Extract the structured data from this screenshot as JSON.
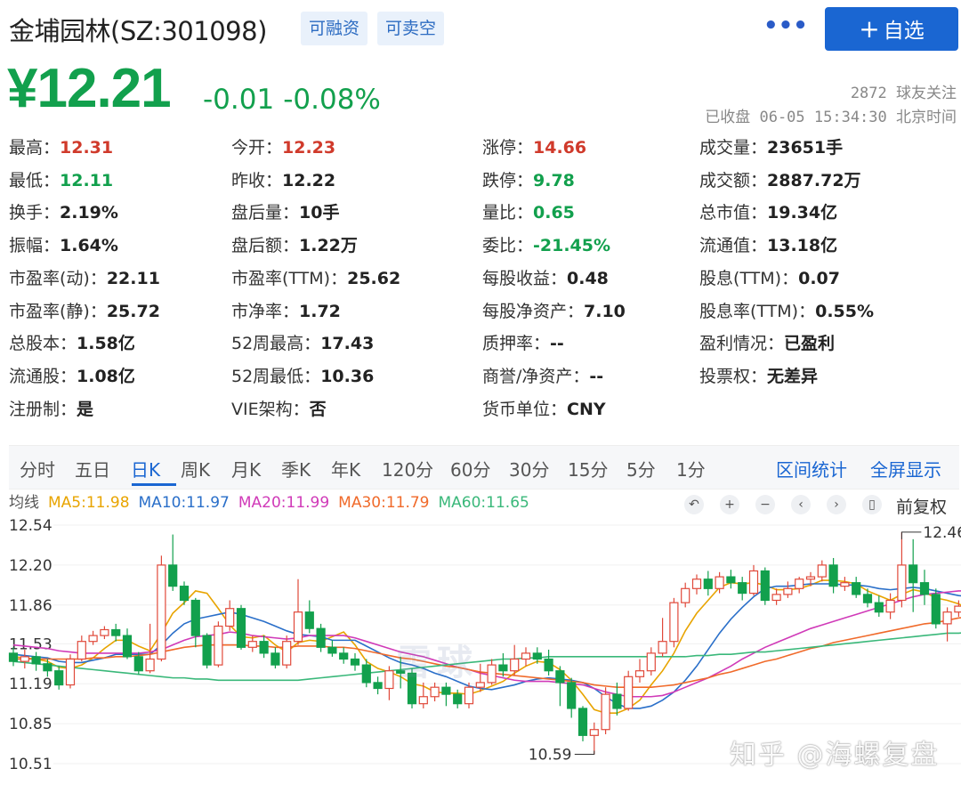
{
  "header": {
    "stock_name": "金埔园林(SZ:301098)",
    "tag1": "可融资",
    "tag2": "可卖空",
    "more_label": "•••",
    "add_label": "自选",
    "add_icon": "plus-icon"
  },
  "quote": {
    "price": "¥12.21",
    "change": "-0.01",
    "change_pct": "-0.08%",
    "followers": "2872 球友关注",
    "status": "已收盘 06-05 15:34:30 北京时间"
  },
  "stats": [
    {
      "label": "最高：",
      "value": "12.31",
      "color": "red"
    },
    {
      "label": "今开：",
      "value": "12.23",
      "color": "red"
    },
    {
      "label": "涨停：",
      "value": "14.66",
      "color": "red"
    },
    {
      "label": "成交量：",
      "value": "23651手",
      "color": ""
    },
    {
      "label": "最低：",
      "value": "12.11",
      "color": "green"
    },
    {
      "label": "昨收：",
      "value": "12.22",
      "color": ""
    },
    {
      "label": "跌停：",
      "value": "9.78",
      "color": "green"
    },
    {
      "label": "成交额：",
      "value": "2887.72万",
      "color": ""
    },
    {
      "label": "换手：",
      "value": "2.19%",
      "color": ""
    },
    {
      "label": "盘后量：",
      "value": "10手",
      "color": ""
    },
    {
      "label": "量比：",
      "value": "0.65",
      "color": "green"
    },
    {
      "label": "总市值：",
      "value": "19.34亿",
      "color": ""
    },
    {
      "label": "振幅：",
      "value": "1.64%",
      "color": ""
    },
    {
      "label": "盘后额：",
      "value": "1.22万",
      "color": ""
    },
    {
      "label": "委比：",
      "value": "-21.45%",
      "color": "green"
    },
    {
      "label": "流通值：",
      "value": "13.18亿",
      "color": ""
    },
    {
      "label": "市盈率(动)：",
      "value": "22.11",
      "color": ""
    },
    {
      "label": "市盈率(TTM)：",
      "value": "25.62",
      "color": ""
    },
    {
      "label": "每股收益：",
      "value": "0.48",
      "color": ""
    },
    {
      "label": "股息(TTM)：",
      "value": "0.07",
      "color": ""
    },
    {
      "label": "市盈率(静)：",
      "value": "25.72",
      "color": ""
    },
    {
      "label": "市净率：",
      "value": "1.72",
      "color": ""
    },
    {
      "label": "每股净资产：",
      "value": "7.10",
      "color": ""
    },
    {
      "label": "股息率(TTM)：",
      "value": "0.55%",
      "color": ""
    },
    {
      "label": "总股本：",
      "value": "1.58亿",
      "color": ""
    },
    {
      "label": "52周最高：",
      "value": "17.43",
      "color": ""
    },
    {
      "label": "质押率：",
      "value": "--",
      "color": ""
    },
    {
      "label": "盈利情况：",
      "value": "已盈利",
      "color": ""
    },
    {
      "label": "流通股：",
      "value": "1.08亿",
      "color": ""
    },
    {
      "label": "52周最低：",
      "value": "10.36",
      "color": ""
    },
    {
      "label": "商誉/净资产：",
      "value": "--",
      "color": ""
    },
    {
      "label": "投票权：",
      "value": "无差异",
      "color": ""
    },
    {
      "label": "注册制：",
      "value": "是",
      "color": ""
    },
    {
      "label": "VIE架构：",
      "value": "否",
      "color": ""
    },
    {
      "label": "货币单位：",
      "value": "CNY",
      "color": ""
    }
  ],
  "tabs": [
    "分时",
    "五日",
    "日K",
    "周K",
    "月K",
    "季K",
    "年K",
    "120分",
    "60分",
    "30分",
    "15分",
    "5分",
    "1分"
  ],
  "active_tab": "日K",
  "tab_actions": [
    "区间统计",
    "全屏显示"
  ],
  "ma": {
    "label": "均线",
    "items": [
      {
        "text": "MA5:11.98",
        "color": "#e8a400"
      },
      {
        "text": "MA10:11.97",
        "color": "#2a6fc9"
      },
      {
        "text": "MA20:11.99",
        "color": "#d03ab8"
      },
      {
        "text": "MA30:11.79",
        "color": "#f06a2a"
      },
      {
        "text": "MA60:11.65",
        "color": "#3ab87a"
      }
    ]
  },
  "controls": [
    {
      "name": "undo-icon",
      "glyph": "↶"
    },
    {
      "name": "zoom-in-icon",
      "glyph": "+"
    },
    {
      "name": "zoom-out-icon",
      "glyph": "−"
    },
    {
      "name": "prev-icon",
      "glyph": "‹"
    },
    {
      "name": "next-icon",
      "glyph": "›"
    },
    {
      "name": "candle-icon",
      "glyph": "▯"
    }
  ],
  "restore_label": "前复权",
  "watermark": "知乎 @海螺复盘",
  "logo_watermark": "雪球",
  "chart_data": {
    "type": "candlestick",
    "y_ticks": [
      "12.54",
      "12.20",
      "11.86",
      "11.53",
      "11.19",
      "10.85",
      "10.51"
    ],
    "ylim": [
      10.51,
      12.54
    ],
    "max_annotation": "12.46",
    "min_annotation": "10.59",
    "up_color": "#e0493a",
    "down_color": "#12a04d",
    "candles": [
      [
        11.45,
        11.38,
        11.5,
        11.34
      ],
      [
        11.38,
        11.42,
        11.48,
        11.32
      ],
      [
        11.42,
        11.36,
        11.46,
        11.3
      ],
      [
        11.36,
        11.3,
        11.4,
        11.25
      ],
      [
        11.3,
        11.18,
        11.34,
        11.14
      ],
      [
        11.18,
        11.4,
        11.44,
        11.15
      ],
      [
        11.4,
        11.55,
        11.6,
        11.38
      ],
      [
        11.55,
        11.6,
        11.64,
        11.52
      ],
      [
        11.6,
        11.65,
        11.68,
        11.57
      ],
      [
        11.65,
        11.6,
        11.7,
        11.55
      ],
      [
        11.6,
        11.42,
        11.66,
        11.4
      ],
      [
        11.42,
        11.3,
        11.46,
        11.27
      ],
      [
        11.3,
        11.4,
        11.7,
        11.28
      ],
      [
        11.4,
        12.2,
        12.28,
        11.38
      ],
      [
        12.2,
        12.02,
        12.46,
        11.98
      ],
      [
        12.02,
        11.9,
        12.06,
        11.86
      ],
      [
        11.9,
        11.6,
        11.92,
        11.5
      ],
      [
        11.6,
        11.35,
        11.62,
        11.32
      ],
      [
        11.35,
        11.68,
        11.72,
        11.33
      ],
      [
        11.68,
        11.83,
        11.9,
        11.64
      ],
      [
        11.83,
        11.5,
        11.86,
        11.48
      ],
      [
        11.5,
        11.55,
        11.6,
        11.46
      ],
      [
        11.55,
        11.45,
        11.6,
        11.41
      ],
      [
        11.45,
        11.35,
        11.5,
        11.32
      ],
      [
        11.35,
        11.55,
        11.6,
        11.32
      ],
      [
        11.55,
        11.8,
        12.08,
        11.52
      ],
      [
        11.8,
        11.66,
        11.9,
        11.62
      ],
      [
        11.66,
        11.5,
        11.7,
        11.46
      ],
      [
        11.5,
        11.45,
        11.56,
        11.42
      ],
      [
        11.45,
        11.4,
        11.5,
        11.36
      ],
      [
        11.4,
        11.35,
        11.45,
        11.3
      ],
      [
        11.35,
        11.2,
        11.4,
        11.16
      ],
      [
        11.2,
        11.15,
        11.25,
        11.1
      ],
      [
        11.15,
        11.3,
        11.34,
        11.05
      ],
      [
        11.3,
        11.28,
        11.42,
        11.15
      ],
      [
        11.28,
        11.02,
        11.32,
        10.98
      ],
      [
        11.02,
        11.08,
        11.2,
        10.98
      ],
      [
        11.08,
        11.16,
        11.2,
        11.04
      ],
      [
        11.16,
        11.1,
        11.2,
        11.0
      ],
      [
        11.1,
        11.02,
        11.14,
        10.98
      ],
      [
        11.02,
        11.16,
        11.2,
        10.98
      ],
      [
        11.16,
        11.2,
        11.36,
        11.12
      ],
      [
        11.2,
        11.35,
        11.4,
        11.18
      ],
      [
        11.35,
        11.3,
        11.45,
        11.25
      ],
      [
        11.3,
        11.4,
        11.52,
        11.26
      ],
      [
        11.4,
        11.45,
        11.5,
        11.34
      ],
      [
        11.45,
        11.4,
        11.5,
        11.36
      ],
      [
        11.4,
        11.3,
        11.48,
        11.26
      ],
      [
        11.3,
        11.2,
        11.34,
        11.0
      ],
      [
        11.2,
        10.98,
        11.24,
        10.9
      ],
      [
        10.98,
        10.75,
        11.0,
        10.7
      ],
      [
        10.75,
        10.8,
        10.86,
        10.59
      ],
      [
        10.8,
        11.1,
        11.16,
        10.76
      ],
      [
        11.1,
        10.98,
        11.2,
        10.92
      ],
      [
        10.98,
        11.25,
        11.3,
        10.96
      ],
      [
        11.25,
        11.3,
        11.4,
        11.2
      ],
      [
        11.3,
        11.45,
        11.5,
        11.26
      ],
      [
        11.45,
        11.55,
        11.75,
        11.42
      ],
      [
        11.55,
        11.88,
        11.92,
        11.5
      ],
      [
        11.88,
        12.0,
        12.05,
        11.84
      ],
      [
        12.0,
        12.08,
        12.12,
        11.95
      ],
      [
        12.08,
        12.0,
        12.15,
        11.94
      ],
      [
        12.0,
        12.1,
        12.14,
        11.96
      ],
      [
        12.1,
        12.05,
        12.16,
        12.0
      ],
      [
        12.05,
        11.96,
        12.1,
        11.9
      ],
      [
        11.96,
        12.15,
        12.2,
        11.94
      ],
      [
        12.15,
        11.9,
        12.18,
        11.86
      ],
      [
        11.9,
        11.95,
        12.0,
        11.86
      ],
      [
        11.95,
        12.0,
        12.06,
        11.92
      ],
      [
        12.0,
        12.08,
        12.1,
        11.96
      ],
      [
        12.08,
        12.1,
        12.14,
        12.02
      ],
      [
        12.1,
        12.2,
        12.24,
        12.06
      ],
      [
        12.2,
        12.02,
        12.26,
        11.96
      ],
      [
        12.02,
        12.05,
        12.1,
        11.98
      ],
      [
        12.05,
        11.95,
        12.1,
        11.92
      ],
      [
        11.95,
        11.88,
        12.0,
        11.84
      ],
      [
        11.88,
        11.8,
        11.94,
        11.76
      ],
      [
        11.8,
        11.9,
        11.96,
        11.74
      ],
      [
        11.9,
        12.2,
        12.48,
        11.84
      ],
      [
        12.2,
        12.05,
        12.42,
        11.8
      ],
      [
        12.05,
        11.95,
        12.16,
        11.86
      ],
      [
        11.95,
        11.7,
        12.0,
        11.66
      ],
      [
        11.7,
        11.8,
        11.84,
        11.55
      ],
      [
        11.8,
        11.85,
        11.9,
        11.76
      ],
      [
        11.85,
        11.8,
        11.9,
        11.56
      ],
      [
        11.8,
        12.22,
        12.24,
        11.78
      ],
      [
        12.22,
        12.21,
        12.31,
        12.11
      ]
    ],
    "ma_series": [
      {
        "name": "MA5",
        "color": "#e8a400",
        "values": [
          11.42,
          11.41,
          11.4,
          11.38,
          11.33,
          11.32,
          11.35,
          11.41,
          11.49,
          11.56,
          11.56,
          11.51,
          11.47,
          11.62,
          11.79,
          11.88,
          11.98,
          11.96,
          11.83,
          11.69,
          11.59,
          11.58,
          11.6,
          11.52,
          11.46,
          11.54,
          11.56,
          11.55,
          11.59,
          11.63,
          11.52,
          11.38,
          11.32,
          11.29,
          11.25,
          11.19,
          11.17,
          11.12,
          11.11,
          11.11,
          11.1,
          11.13,
          11.17,
          11.21,
          11.28,
          11.34,
          11.38,
          11.37,
          11.31,
          11.22,
          11.1,
          10.97,
          10.94,
          10.94,
          10.98,
          11.05,
          11.18,
          11.3,
          11.45,
          11.64,
          11.79,
          11.9,
          12.01,
          12.05,
          12.04,
          12.05,
          12.03,
          11.99,
          11.99,
          12.0,
          12.03,
          12.07,
          12.07,
          12.06,
          12.04,
          11.98,
          11.94,
          11.9,
          11.95,
          11.99,
          11.97,
          11.92,
          11.9,
          11.87,
          11.82,
          11.89,
          11.98
        ]
      },
      {
        "name": "MA10",
        "color": "#2a6fc9",
        "values": [
          11.44,
          11.43,
          11.42,
          11.41,
          11.38,
          11.37,
          11.37,
          11.39,
          11.41,
          11.44,
          11.44,
          11.44,
          11.44,
          11.52,
          11.62,
          11.7,
          11.74,
          11.76,
          11.78,
          11.8,
          11.78,
          11.75,
          11.72,
          11.68,
          11.64,
          11.61,
          11.6,
          11.59,
          11.56,
          11.56,
          11.56,
          11.51,
          11.46,
          11.41,
          11.37,
          11.35,
          11.32,
          11.28,
          11.25,
          11.21,
          11.17,
          11.15,
          11.14,
          11.16,
          11.18,
          11.21,
          11.23,
          11.24,
          11.23,
          11.22,
          11.2,
          11.15,
          11.08,
          11.02,
          10.98,
          10.98,
          11.0,
          11.05,
          11.12,
          11.22,
          11.34,
          11.48,
          11.62,
          11.74,
          11.84,
          11.93,
          12.0,
          12.02,
          12.02,
          12.03,
          12.04,
          12.04,
          12.04,
          12.03,
          12.03,
          12.02,
          12.0,
          11.99,
          12.0,
          12.01,
          12.0,
          11.98,
          11.96,
          11.94,
          11.93,
          11.94,
          11.97
        ]
      },
      {
        "name": "MA20",
        "color": "#d03ab8",
        "values": [
          11.52,
          11.51,
          11.5,
          11.49,
          11.47,
          11.46,
          11.45,
          11.45,
          11.45,
          11.45,
          11.45,
          11.45,
          11.46,
          11.48,
          11.52,
          11.56,
          11.59,
          11.6,
          11.61,
          11.63,
          11.62,
          11.6,
          11.59,
          11.58,
          11.57,
          11.58,
          11.6,
          11.6,
          11.6,
          11.6,
          11.58,
          11.55,
          11.52,
          11.49,
          11.46,
          11.44,
          11.42,
          11.39,
          11.36,
          11.33,
          11.31,
          11.28,
          11.26,
          11.24,
          11.22,
          11.21,
          11.21,
          11.21,
          11.2,
          11.19,
          11.18,
          11.15,
          11.12,
          11.1,
          11.08,
          11.08,
          11.08,
          11.09,
          11.12,
          11.16,
          11.2,
          11.24,
          11.29,
          11.34,
          11.4,
          11.45,
          11.5,
          11.54,
          11.58,
          11.62,
          11.66,
          11.69,
          11.72,
          11.75,
          11.78,
          11.81,
          11.84,
          11.87,
          11.9,
          11.93,
          11.95,
          11.96,
          11.97,
          11.98,
          11.98,
          11.98,
          11.99
        ]
      },
      {
        "name": "MA30",
        "color": "#f06a2a",
        "values": [
          11.4,
          11.4,
          11.4,
          11.4,
          11.4,
          11.4,
          11.4,
          11.41,
          11.41,
          11.42,
          11.42,
          11.43,
          11.44,
          11.46,
          11.48,
          11.5,
          11.51,
          11.52,
          11.52,
          11.52,
          11.52,
          11.51,
          11.51,
          11.5,
          11.5,
          11.51,
          11.51,
          11.51,
          11.5,
          11.5,
          11.49,
          11.47,
          11.45,
          11.43,
          11.41,
          11.4,
          11.38,
          11.36,
          11.34,
          11.33,
          11.31,
          11.29,
          11.28,
          11.27,
          11.26,
          11.25,
          11.24,
          11.23,
          11.22,
          11.21,
          11.2,
          11.18,
          11.17,
          11.16,
          11.16,
          11.16,
          11.16,
          11.17,
          11.18,
          11.2,
          11.22,
          11.24,
          11.27,
          11.29,
          11.32,
          11.35,
          11.38,
          11.4,
          11.43,
          11.46,
          11.49,
          11.51,
          11.54,
          11.56,
          11.58,
          11.6,
          11.62,
          11.64,
          11.66,
          11.68,
          11.7,
          11.71,
          11.73,
          11.75,
          11.76,
          11.77,
          11.79
        ]
      },
      {
        "name": "MA60",
        "color": "#3ab87a",
        "values": [
          11.38,
          11.37,
          11.36,
          11.35,
          11.34,
          11.33,
          11.32,
          11.31,
          11.3,
          11.29,
          11.28,
          11.27,
          11.26,
          11.25,
          11.24,
          11.24,
          11.23,
          11.23,
          11.22,
          11.22,
          11.22,
          11.22,
          11.22,
          11.22,
          11.22,
          11.22,
          11.23,
          11.24,
          11.25,
          11.26,
          11.27,
          11.28,
          11.29,
          11.3,
          11.31,
          11.32,
          11.33,
          11.34,
          11.35,
          11.36,
          11.37,
          11.38,
          11.39,
          11.4,
          11.4,
          11.41,
          11.41,
          11.42,
          11.42,
          11.42,
          11.42,
          11.42,
          11.42,
          11.42,
          11.42,
          11.42,
          11.42,
          11.42,
          11.42,
          11.42,
          11.43,
          11.43,
          11.44,
          11.44,
          11.45,
          11.46,
          11.46,
          11.47,
          11.48,
          11.49,
          11.5,
          11.51,
          11.52,
          11.53,
          11.54,
          11.55,
          11.56,
          11.57,
          11.58,
          11.59,
          11.6,
          11.61,
          11.62,
          11.62,
          11.63,
          11.64,
          11.65
        ]
      }
    ]
  }
}
